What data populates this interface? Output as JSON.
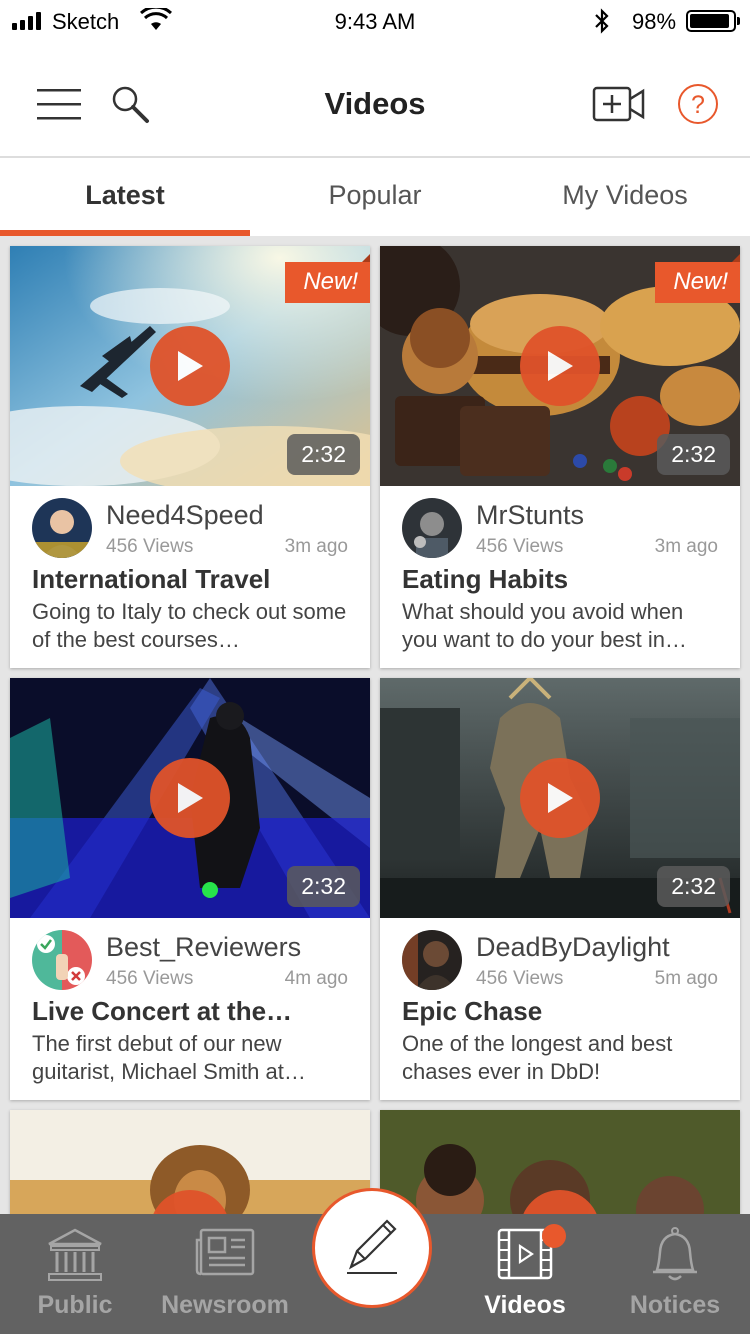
{
  "status_bar": {
    "carrier": "Sketch",
    "time": "9:43 AM",
    "battery": "98%",
    "battery_level": 0.98
  },
  "nav": {
    "title": "Videos",
    "icons": [
      "menu-icon",
      "search-icon",
      "add-video-icon",
      "help-icon"
    ]
  },
  "tabs": [
    {
      "label": "Latest",
      "active": true
    },
    {
      "label": "Popular",
      "active": false
    },
    {
      "label": "My Videos",
      "active": false
    }
  ],
  "cards": [
    {
      "new_badge": "New!",
      "duration": "2:32",
      "author": "Need4Speed",
      "views": "456 Views",
      "ago": "3m ago",
      "title": "International Travel",
      "description": "Going to Italy to check out some of the best courses…"
    },
    {
      "new_badge": "New!",
      "duration": "2:32",
      "author": "MrStunts",
      "views": "456 Views",
      "ago": "3m ago",
      "title": "Eating Habits",
      "description": "What should you avoid when you want to do your best in…"
    },
    {
      "duration": "2:32",
      "author": "Best_Reviewers",
      "views": "456 Views",
      "ago": "4m ago",
      "title": "Live Concert at the…",
      "description": "The first debut of our new guitarist, Michael Smith at…"
    },
    {
      "duration": "2:32",
      "author": "DeadByDaylight",
      "views": "456 Views",
      "ago": "5m ago",
      "title": "Epic Chase",
      "description": "One of the longest and best chases ever in DbD!"
    }
  ],
  "tab_bar": {
    "items": [
      {
        "label": "Public",
        "icon": "public-building-icon",
        "active": false
      },
      {
        "label": "Newsroom",
        "icon": "newspaper-icon",
        "active": false
      },
      {
        "label": "Videos",
        "icon": "film-icon",
        "active": true
      },
      {
        "label": "Notices",
        "icon": "bell-icon",
        "active": false
      }
    ],
    "compose_icon": "pen-icon"
  },
  "colors": {
    "accent": "#e8582c",
    "tab_bar_bg": "#626262"
  }
}
